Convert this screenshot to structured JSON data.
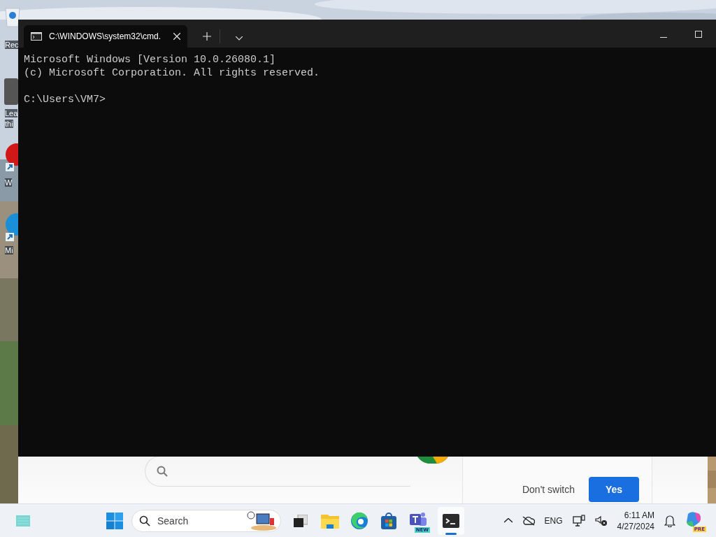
{
  "desktop": {
    "icons": [
      {
        "label": "Rec",
        "kind": "bin"
      },
      {
        "label": "Lea",
        "kind": "box"
      },
      {
        "label": "thi",
        "kind": "none"
      },
      {
        "label": "W",
        "kind": "red"
      },
      {
        "label": "Mi",
        "kind": "blue"
      }
    ]
  },
  "terminal": {
    "tab": {
      "title": "C:\\WINDOWS\\system32\\cmd.",
      "selected": true
    },
    "output": [
      "Microsoft Windows [Version 10.0.26080.1]",
      "(c) Microsoft Corporation. All rights reserved."
    ],
    "prompt": "C:\\Users\\VM7>"
  },
  "browser": {
    "buttons": [
      {
        "label": "Don't switch",
        "kind": "text"
      },
      {
        "label": "Yes",
        "kind": "primary"
      }
    ]
  },
  "taskbar": {
    "search": {
      "placeholder": "Search"
    },
    "apps": [
      {
        "kind": "taskview",
        "selected": false
      },
      {
        "kind": "explorer",
        "selected": false
      },
      {
        "kind": "edge",
        "selected": false
      },
      {
        "kind": "store",
        "selected": false
      },
      {
        "kind": "teams",
        "badge": "NEW",
        "selected": false
      },
      {
        "kind": "terminal",
        "selected": true
      }
    ],
    "tray": {
      "language": "ENG",
      "time": "6:11 AM",
      "date": "4/27/2024",
      "copilot_badge": "PRE"
    }
  }
}
